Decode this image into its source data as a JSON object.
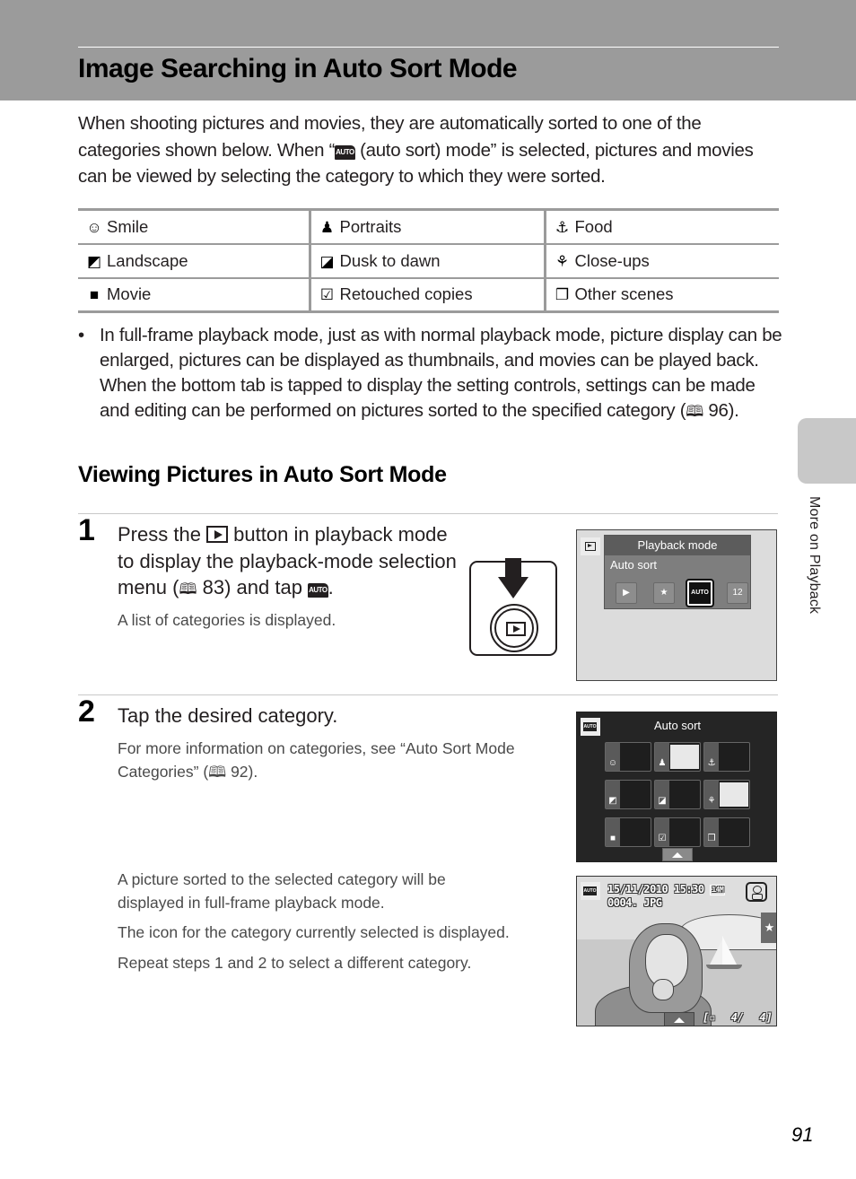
{
  "header": {
    "title": "Image Searching in Auto Sort Mode"
  },
  "intro": {
    "part1": "When shooting pictures and movies, they are automatically sorted to one of the categories shown below. When “",
    "auto_icon": "AUTO",
    "part2": " (auto sort) mode” is selected, pictures and movies can be viewed by selecting the category to which they were sorted."
  },
  "categories": [
    [
      {
        "icon": "smile-icon",
        "glyph": "☺",
        "label": "Smile"
      },
      {
        "icon": "portrait-icon",
        "glyph": "♟",
        "label": "Portraits"
      },
      {
        "icon": "food-icon",
        "glyph": "⚓",
        "label": "Food"
      }
    ],
    [
      {
        "icon": "landscape-icon",
        "glyph": "◩",
        "label": "Landscape"
      },
      {
        "icon": "dusk-to-dawn-icon",
        "glyph": "◪",
        "label": "Dusk to dawn"
      },
      {
        "icon": "close-up-icon",
        "glyph": "⚘",
        "label": "Close-ups"
      }
    ],
    [
      {
        "icon": "movie-icon",
        "glyph": "■",
        "label": "Movie"
      },
      {
        "icon": "retouched-icon",
        "glyph": "☑",
        "label": "Retouched copies"
      },
      {
        "icon": "other-scenes-icon",
        "glyph": "❐",
        "label": "Other scenes"
      }
    ]
  ],
  "bullet": {
    "dot": "•",
    "text": "In full-frame playback mode, just as with normal playback mode, picture display can be enlarged, pictures can be displayed as thumbnails, and movies can be played back. When the bottom tab is tapped to display the setting controls, settings can be made and editing can be performed on pictures sorted to the specified category (",
    "ref": "🕮",
    "ref_page": " 96)."
  },
  "section": {
    "title": "Viewing Pictures in Auto Sort Mode"
  },
  "steps": [
    {
      "number": "1",
      "head_part1": "Press the ",
      "head_part2": " button in playback mode to display the playback-mode selection menu (",
      "head_ref": " 83) and tap ",
      "head_auto": "AUTO",
      "head_end": ".",
      "body": "A list of categories is displayed."
    },
    {
      "number": "2",
      "head": "Tap the desired category.",
      "body1_part1": "For more information on categories, see “Auto Sort Mode Categories” (",
      "body1_ref": " 92).",
      "body2": "A picture sorted to the selected category will be displayed in full-frame playback mode.",
      "body3": "The icon for the category currently selected is displayed.",
      "body4": "Repeat steps 1 and 2 to select a different category."
    }
  ],
  "book_glyph": "🕮",
  "screen1": {
    "menu_title": "Playback mode",
    "menu_label": "Auto sort",
    "icons": [
      {
        "name": "playback-icon",
        "glyph": "▶"
      },
      {
        "name": "favorite-pictures-icon",
        "glyph": "★"
      },
      {
        "name": "auto-sort-icon",
        "glyph": "AUTO",
        "selected": true
      },
      {
        "name": "list-by-date-icon",
        "glyph": "12"
      }
    ]
  },
  "screen2": {
    "tab_glyph": "AUTO",
    "title": "Auto sort",
    "cells": [
      {
        "name": "smile",
        "glyph": "☺",
        "thumb": false
      },
      {
        "name": "portraits",
        "glyph": "♟",
        "thumb": true
      },
      {
        "name": "food",
        "glyph": "⚓",
        "thumb": false
      },
      {
        "name": "landscape",
        "glyph": "◩",
        "thumb": false
      },
      {
        "name": "dusk-to-dawn",
        "glyph": "◪",
        "thumb": false
      },
      {
        "name": "close-ups",
        "glyph": "⚘",
        "thumb": true
      },
      {
        "name": "movie",
        "glyph": "■",
        "thumb": false
      },
      {
        "name": "retouched",
        "glyph": "☑",
        "thumb": false
      },
      {
        "name": "other-scenes",
        "glyph": "❐",
        "thumb": false
      }
    ]
  },
  "screen3": {
    "tab_glyph": "AUTO",
    "datetime": "15/11/2010 15:30",
    "image_size": "14M",
    "filename": "0004. JPG",
    "star": "★",
    "counter": "[▫ 4/ 4]"
  },
  "side_tab": {
    "label": "More on Playback"
  },
  "page_number": "91"
}
